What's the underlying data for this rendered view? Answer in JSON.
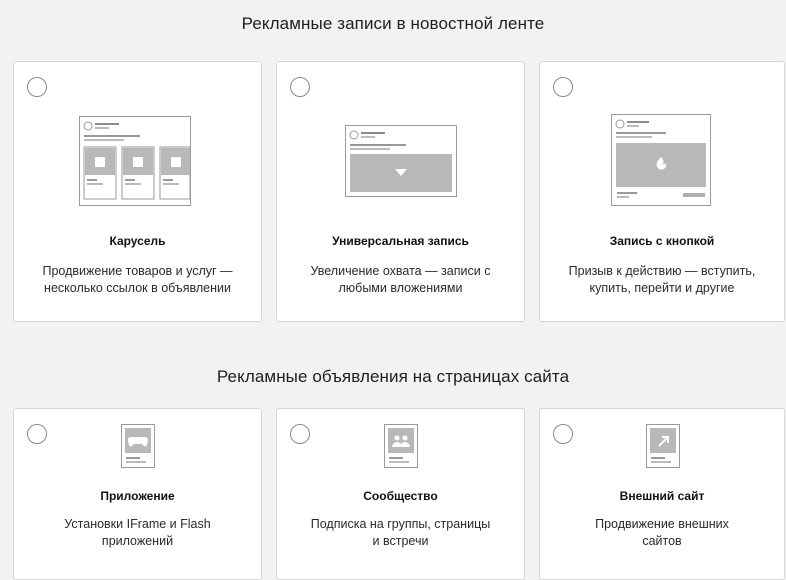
{
  "sections": {
    "feed": {
      "title": "Рекламные записи в новостной ленте",
      "cards": [
        {
          "title": "Карусель",
          "desc_line1": "Продвижение товаров и услуг —",
          "desc_line2": "несколько ссылок в объявлении",
          "icon": "carousel-preview-icon"
        },
        {
          "title": "Универсальная запись",
          "desc_line1": "Увеличение охвата — записи с",
          "desc_line2": "любыми вложениями",
          "icon": "universal-post-preview-icon"
        },
        {
          "title": "Запись с кнопкой",
          "desc_line1": "Призыв к действию — вступить,",
          "desc_line2": "купить, перейти и другие",
          "icon": "button-post-preview-icon"
        }
      ]
    },
    "site": {
      "title": "Рекламные объявления на страницах сайта",
      "cards": [
        {
          "title": "Приложение",
          "desc_line1": "Установки IFrame и Flash",
          "desc_line2": "приложений",
          "icon": "gamepad-icon"
        },
        {
          "title": "Сообщество",
          "desc_line1": "Подписка на группы, страницы",
          "desc_line2": "и встречи",
          "icon": "people-icon"
        },
        {
          "title": "Внешний сайт",
          "desc_line1": "Продвижение внешних",
          "desc_line2": "сайтов",
          "icon": "external-link-icon"
        }
      ]
    }
  },
  "colors": {
    "page_bg": "#f2f2f2",
    "card_bg": "#ffffff",
    "card_border": "#d6d6d6",
    "illustration_gray": "#b8b8b8"
  }
}
